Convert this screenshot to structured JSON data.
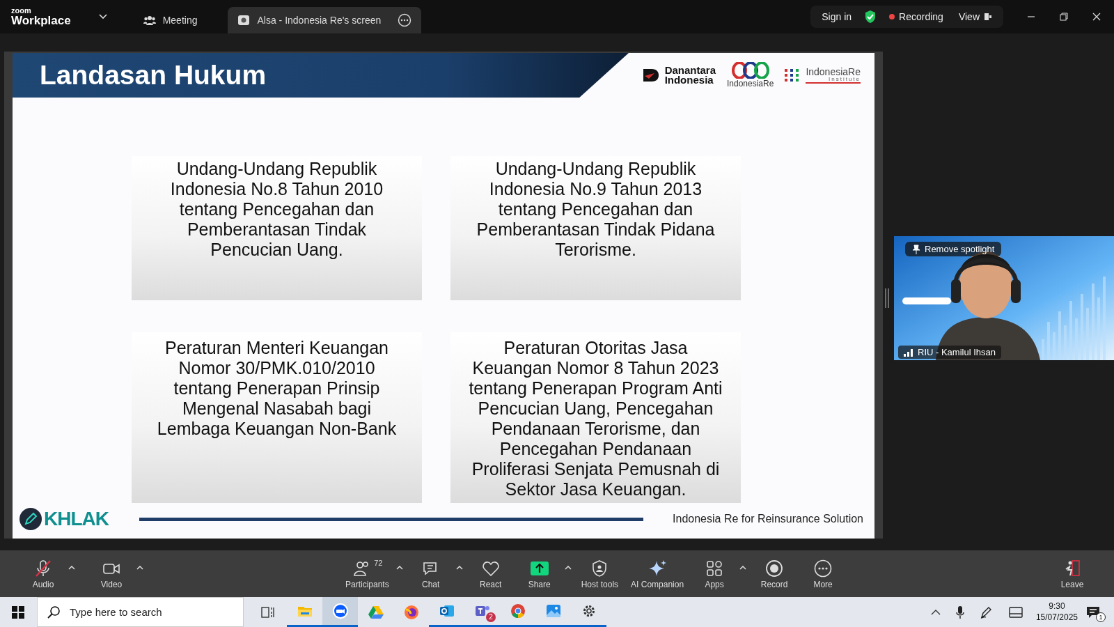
{
  "app": {
    "logo_small": "zoom",
    "logo": "Workplace"
  },
  "tabs": [
    {
      "label": "Meeting",
      "selected": false
    },
    {
      "label": "Alsa - Indonesia Re's screen",
      "selected": true
    }
  ],
  "top_actions": {
    "sign_in": "Sign in",
    "recording": "Recording",
    "view": "View"
  },
  "slide": {
    "title": "Landasan Hukum",
    "logos": {
      "danantara_1": "Danantara",
      "danantara_2": "Indonesia",
      "indonesiare": "IndonesiaRe",
      "institute_1": "IndonesiaRe",
      "institute_2": "Institute"
    },
    "boxes": [
      "Undang-Undang Republik Indonesia No.8 Tahun 2010 tentang Pencegahan dan Pemberantasan Tindak Pencucian Uang.",
      "Undang-Undang Republik Indonesia No.9 Tahun 2013 tentang Pencegahan dan Pemberantasan Tindak Pidana Terorisme.",
      "Peraturan Menteri Keuangan Nomor 30/PMK.010/2010 tentang Penerapan Prinsip Mengenal Nasabah bagi Lembaga Keuangan Non-Bank",
      "Peraturan Otoritas Jasa Keuangan Nomor 8 Tahun 2023 tentang Penerapan Program Anti Pencucian Uang, Pencegahan Pendanaan Terorisme, dan Pencegahan Pendanaan Proliferasi Senjata Pemusnah di Sektor Jasa Keuangan."
    ],
    "footer_logo": "KHLAK",
    "tagline": "Indonesia Re for Reinsurance Solution"
  },
  "video": {
    "kind": "picture",
    "spotlight": "Remove spotlight",
    "name": "RIU - Kamilul Ihsan"
  },
  "toolbar": [
    {
      "kind": "audio",
      "label": "Audio",
      "muted": true,
      "menu": true
    },
    {
      "kind": "video",
      "label": "Video",
      "muted": false,
      "menu": true
    },
    {
      "kind": "participants",
      "label": "Participants",
      "count": "72",
      "menu": true
    },
    {
      "kind": "chat",
      "label": "Chat",
      "menu": true
    },
    {
      "kind": "react",
      "label": "React",
      "menu": false
    },
    {
      "kind": "share",
      "label": "Share",
      "menu": true
    },
    {
      "kind": "host",
      "label": "Host tools",
      "menu": false
    },
    {
      "kind": "ai",
      "label": "AI Companion",
      "menu": false
    },
    {
      "kind": "apps",
      "label": "Apps",
      "menu": true
    },
    {
      "kind": "record",
      "label": "Record",
      "menu": false
    },
    {
      "kind": "more",
      "label": "More",
      "menu": false
    },
    {
      "kind": "leave",
      "label": "Leave",
      "menu": false
    }
  ],
  "taskbar": {
    "search": {
      "placeholder": "Type here to search"
    },
    "apps": [
      {
        "kind": "explorer",
        "running": true,
        "selected": false
      },
      {
        "kind": "zoom",
        "running": true,
        "selected": true
      },
      {
        "kind": "drive",
        "running": false,
        "selected": false
      },
      {
        "kind": "firefox",
        "running": false,
        "selected": false
      },
      {
        "kind": "outlook",
        "running": true,
        "selected": false
      },
      {
        "kind": "teams",
        "running": true,
        "selected": false,
        "badge": "2"
      },
      {
        "kind": "chrome",
        "running": true,
        "selected": false
      },
      {
        "kind": "photos",
        "running": true,
        "selected": false
      },
      {
        "kind": "settings",
        "running": true,
        "selected": false
      }
    ],
    "time": "9:30",
    "date": "15/07/2025",
    "notifications": "1"
  }
}
